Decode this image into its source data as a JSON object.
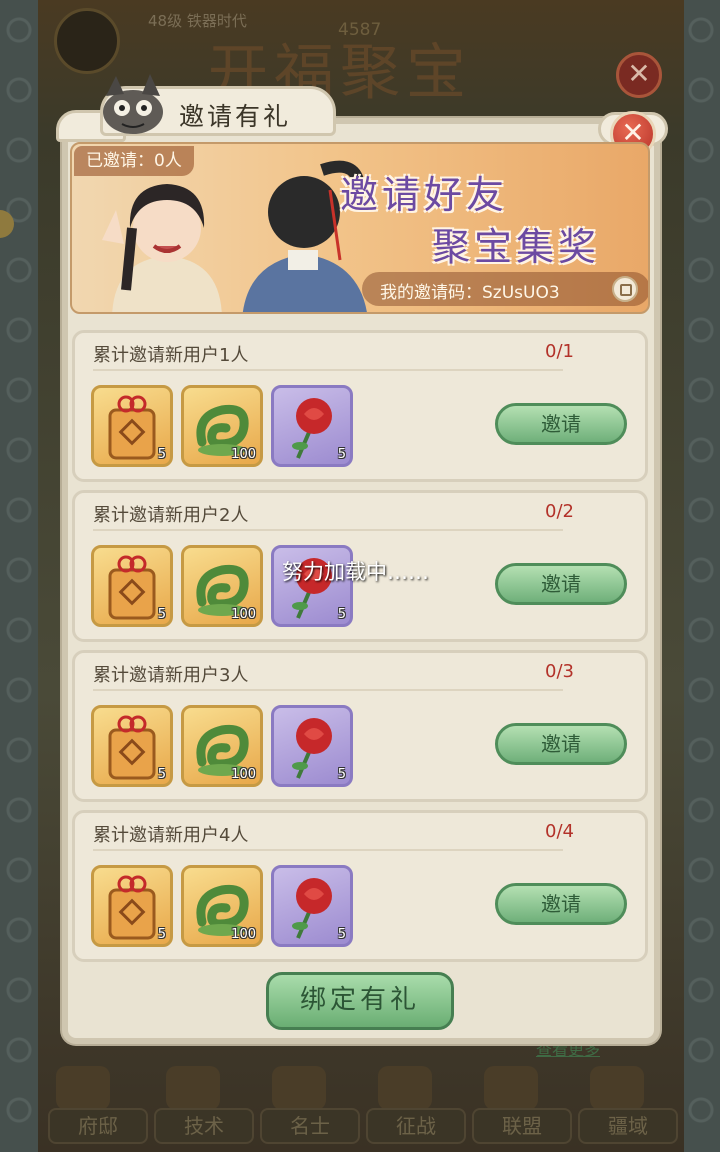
{
  "background": {
    "level_text": "48级 铁器时代",
    "gold_text": "4587",
    "big_title": "开福聚宝",
    "view_more": "查看更多",
    "nav": [
      "府邸",
      "技术",
      "名士",
      "征战",
      "联盟",
      "疆域"
    ]
  },
  "dialog": {
    "title": "邀请有礼",
    "banner": {
      "invited": "已邀请：0人",
      "headline1": "邀请好友",
      "headline2": "聚宝集奖",
      "invite_code": "我的邀请码：SzUsUO3"
    },
    "rows": [
      {
        "label": "累计邀请新用户1人",
        "progress": "0/1",
        "qty": [
          "5",
          "100",
          "5"
        ],
        "button": "邀请"
      },
      {
        "label": "累计邀请新用户2人",
        "progress": "0/2",
        "qty": [
          "5",
          "100",
          "5"
        ],
        "button": "邀请"
      },
      {
        "label": "累计邀请新用户3人",
        "progress": "0/3",
        "qty": [
          "5",
          "100",
          "5"
        ],
        "button": "邀请"
      },
      {
        "label": "累计邀请新用户4人",
        "progress": "0/4",
        "qty": [
          "5",
          "100",
          "5"
        ],
        "button": "邀请"
      }
    ],
    "bind_button": "绑定有礼",
    "close_symbol": "✕"
  },
  "loading_text": "努力加载中……",
  "colors": {
    "accent_green": "#6fb07a",
    "progress_red": "#b3322a",
    "headline_purple": "#6c4aa2"
  }
}
